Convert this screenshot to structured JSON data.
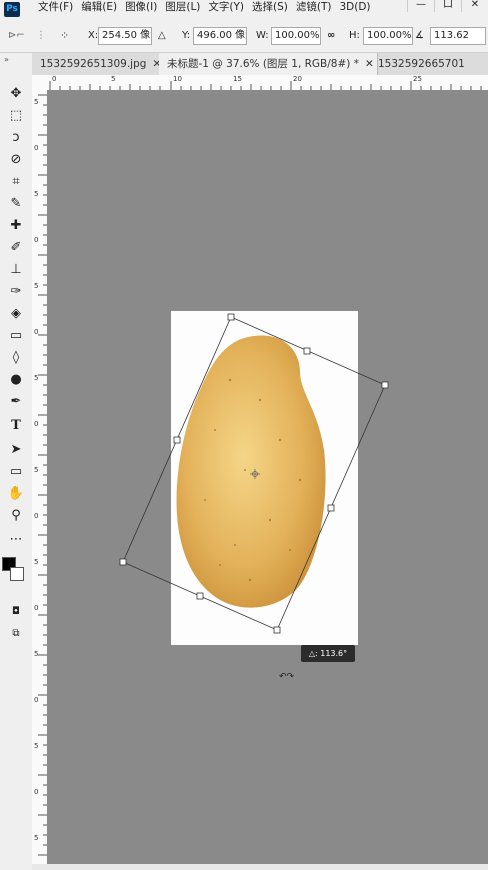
{
  "app": {
    "logo": "Ps"
  },
  "menu": {
    "items": [
      "文件(F)",
      "编辑(E)",
      "图像(I)",
      "图层(L)",
      "文字(Y)",
      "选择(S)",
      "滤镜(T)",
      "3D(D)"
    ]
  },
  "window": {
    "minimize": "—",
    "restore": "口",
    "close": "✕"
  },
  "options": {
    "x_label": "X:",
    "x_value": "254.50 像素",
    "y_label": "Y:",
    "y_value": "496.00 像素",
    "w_label": "W:",
    "w_value": "100.00%",
    "h_label": "H:",
    "h_value": "100.00%",
    "angle_value": "113.62"
  },
  "tabs": [
    {
      "label": "1532592651309.jpg",
      "close": "✕"
    },
    {
      "label": "未标题-1 @ 37.6% (图层 1, RGB/8#) *",
      "close": "✕"
    },
    {
      "label": "1532592665701",
      "close": ""
    }
  ],
  "hruler_labels": [
    "0",
    "5",
    "10",
    "15",
    "20",
    "25"
  ],
  "vruler_labels": [
    "5",
    "0",
    "5",
    "0",
    "5",
    "0",
    "5",
    "0",
    "5",
    "0",
    "5",
    "0",
    "5",
    "0",
    "5",
    "0",
    "5"
  ],
  "rotation_tip": "△: 113.6°",
  "tools": [
    "move-tool-icon",
    "marquee-tool-icon",
    "lasso-tool-icon",
    "quick-select-icon",
    "crop-tool-icon",
    "eyedropper-icon",
    "healing-brush-icon",
    "brush-tool-icon",
    "clone-stamp-icon",
    "history-brush-icon",
    "eraser-icon",
    "gradient-tool-icon",
    "blur-tool-icon",
    "dodge-tool-icon",
    "pen-tool-icon",
    "type-tool-icon",
    "path-select-icon",
    "rectangle-tool-icon",
    "hand-tool-icon",
    "zoom-tool-icon",
    "more-tools-icon"
  ],
  "colors": {
    "accent": "#31a8ff",
    "canvas_bg": "#8a8a8a",
    "potato": "#e3b25a"
  }
}
